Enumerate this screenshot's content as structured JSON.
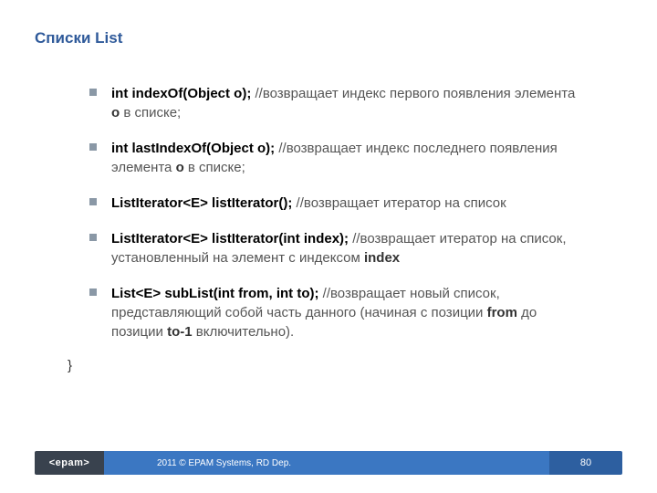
{
  "title": "Списки List",
  "items": [
    {
      "sig": "int indexOf(Object o);",
      "c1": " //возвращает индекс первого появления элемента ",
      "k1": "о",
      "c2": " в списке;"
    },
    {
      "sig": "int lastIndexOf(Object o);",
      "c1": " //возвращает индекс последнего появления элемента ",
      "k1": "о",
      "c2": " в списке;"
    },
    {
      "sig": "ListIterator<E> listIterator();",
      "c1": " //возвращает итератор на список",
      "k1": "",
      "c2": ""
    },
    {
      "sig": "ListIterator<E> listIterator(int index);",
      "c1": " //возвращает итератор на список, установленный на элемент с индексом ",
      "k1": "index",
      "c2": ""
    },
    {
      "sig": "List<E> subList(int from, int to);",
      "c1": " //возвращает новый список, представляющий собой часть данного (начиная с позиции ",
      "k1": "from",
      "c2": " до позиции ",
      "k2": "to-1",
      "c3": " включительно)."
    }
  ],
  "closing": "}",
  "footer": {
    "logo": "<epam>",
    "copyright": "2011 © EPAM Systems, RD Dep.",
    "page": "80"
  }
}
